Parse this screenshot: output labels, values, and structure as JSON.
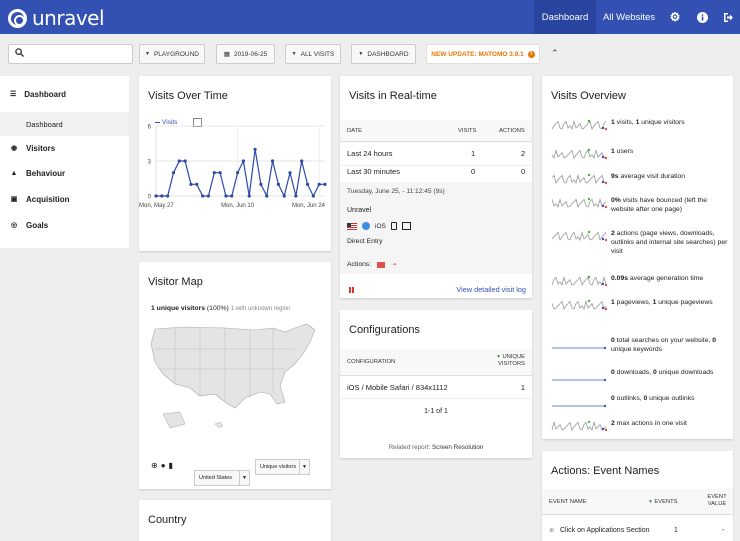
{
  "app": {
    "name": "unravel"
  },
  "topnav": {
    "dashboard": "Dashboard",
    "all_websites": "All Websites",
    "icons": [
      "gear-icon",
      "info-icon",
      "logout-icon"
    ]
  },
  "subbar": {
    "search_placeholder": "",
    "site": "PLAYGROUND",
    "date": "2019-06-25",
    "segment": "ALL VISITS",
    "dashboard": "DASHBOARD",
    "update": "NEW UPDATE: MATOMO 3.9.1"
  },
  "sidebar": {
    "items": [
      {
        "label": "Dashboard",
        "icon": "grid-icon"
      },
      {
        "label": "Dashboard",
        "sub": true
      },
      {
        "label": "Visitors",
        "icon": "eye-icon"
      },
      {
        "label": "Behaviour",
        "icon": "bell-icon"
      },
      {
        "label": "Acquisition",
        "icon": "box-icon"
      },
      {
        "label": "Goals",
        "icon": "target-icon"
      }
    ]
  },
  "visits_over_time": {
    "title": "Visits Over Time",
    "legend": "Visits",
    "chart_data": {
      "type": "line",
      "x_tick_labels": [
        "Mon, May 27",
        "Mon, Jun 10",
        "Mon, Jun 24"
      ],
      "ylim": [
        0,
        6
      ],
      "y_ticks": [
        0,
        3,
        6
      ],
      "series": [
        {
          "name": "Visits",
          "values": [
            0,
            0,
            0,
            2,
            3,
            3,
            1,
            1,
            0,
            0,
            2,
            2,
            0,
            0,
            2,
            3,
            0,
            4,
            1,
            0,
            3,
            1,
            0,
            2,
            0,
            3,
            1,
            0,
            1,
            1
          ]
        }
      ]
    }
  },
  "realtime": {
    "title": "Visits in Real-time",
    "headers": {
      "date": "DATE",
      "visits": "VISITS",
      "actions": "ACTIONS"
    },
    "rows": [
      {
        "label": "Last 24 hours",
        "visits": "1",
        "actions": "2"
      },
      {
        "label": "Last 30 minutes",
        "visits": "0",
        "actions": "0"
      }
    ],
    "visit_time": "Tuesday, June 25, - 11:12:45 (9s)",
    "site": "Unravel",
    "os": "iOS",
    "referrer": "Direct Entry",
    "actions_label": "Actions:",
    "link": "View detailed visit log"
  },
  "configurations": {
    "title": "Configurations",
    "col_config": "CONFIGURATION",
    "col_visitors": "UNIQUE VISITORS",
    "row_label": "iOS / Mobile Safari / 834x1112",
    "row_value": "1",
    "pagination": "1-1 of 1",
    "related_prefix": "Related report:",
    "related_link": "Screen Resolution"
  },
  "visitor_map": {
    "title": "Visitor Map",
    "summary_bold": "1 unique visitors",
    "summary_pct": "(100%)",
    "summary_grey": "1 with unknown region",
    "region": "United States",
    "metric": "Unique visitors"
  },
  "country": {
    "title": "Country"
  },
  "overview": {
    "title": "Visits Overview",
    "items": [
      {
        "b1": "1",
        "t1": " visits, ",
        "b2": "1",
        "t2": " unique visitors",
        "flat": false
      },
      {
        "b1": "1",
        "t1": " users",
        "b2": "",
        "t2": "",
        "flat": false
      },
      {
        "b1": "9s",
        "t1": " average visit duration",
        "b2": "",
        "t2": "",
        "flat": false
      },
      {
        "b1": "0%",
        "t1": " visits have bounced (left the website after one page)",
        "b2": "",
        "t2": "",
        "flat": false
      },
      {
        "b1": "2",
        "t1": " actions (page views, downloads, outlinks and internal site searches) per visit",
        "b2": "",
        "t2": "",
        "flat": false
      },
      {
        "b1": "0.09s",
        "t1": " average generation time",
        "b2": "",
        "t2": "",
        "flat": false
      },
      {
        "b1": "1",
        "t1": " pageviews, ",
        "b2": "1",
        "t2": " unique pageviews",
        "flat": false
      },
      {
        "b1": "0",
        "t1": " total searches on your website, ",
        "b2": "0",
        "t2": " unique keywords",
        "flat": true
      },
      {
        "b1": "0",
        "t1": " downloads, ",
        "b2": "0",
        "t2": " unique downloads",
        "flat": true
      },
      {
        "b1": "0",
        "t1": " outlinks, ",
        "b2": "0",
        "t2": " unique outlinks",
        "flat": true
      },
      {
        "b1": "2",
        "t1": " max actions in one visit",
        "b2": "",
        "t2": "",
        "flat": false
      }
    ]
  },
  "event_names": {
    "title": "Actions: Event Names",
    "col_name": "EVENT NAME",
    "col_events": "EVENTS",
    "col_value": "EVENT VALUE",
    "row_label": "Click on Applications Section",
    "row_events": "1",
    "row_value": "-"
  },
  "colors": {
    "brand": "#3350b3",
    "update": "#e67700",
    "link": "#3450b4"
  }
}
